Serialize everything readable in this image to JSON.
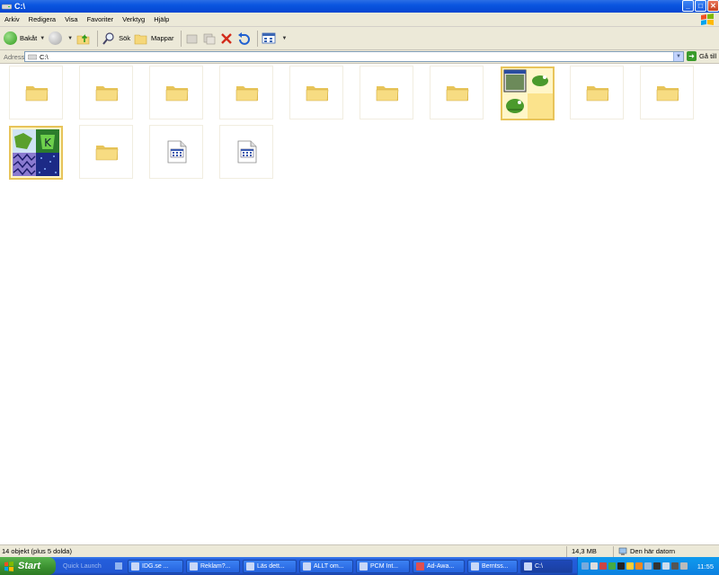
{
  "window": {
    "title": "C:\\",
    "minimize": "_",
    "maximize": "□",
    "close": "✕"
  },
  "menu": [
    "Arkiv",
    "Redigera",
    "Visa",
    "Favoriter",
    "Verktyg",
    "Hjälp"
  ],
  "toolbar": {
    "back_label": "Bakåt",
    "search_label": "Sök",
    "folders_label": "Mappar"
  },
  "address": {
    "label": "Adress",
    "value": "C:\\",
    "go_label": "Gå till"
  },
  "items": [
    {
      "type": "folder"
    },
    {
      "type": "folder"
    },
    {
      "type": "folder"
    },
    {
      "type": "folder"
    },
    {
      "type": "folder"
    },
    {
      "type": "folder"
    },
    {
      "type": "folder"
    },
    {
      "type": "thumbnail-crocodiles"
    },
    {
      "type": "folder"
    },
    {
      "type": "folder"
    },
    {
      "type": "thumbnail-mixed"
    },
    {
      "type": "folder"
    },
    {
      "type": "document"
    },
    {
      "type": "document"
    }
  ],
  "status": {
    "count": "14 objekt (plus 5 dolda)",
    "size": "14,3 MB",
    "location": "Den här datorn"
  },
  "taskbar": {
    "start": "Start",
    "quick_launch": "Quick Launch",
    "tasks": [
      "IDG.se ...",
      "Reklam?...",
      "Läs dett...",
      "ALLT om...",
      "PCM Int...",
      "Ad-Awa...",
      "Berntss...",
      "C:\\"
    ],
    "clock": "11:55"
  },
  "colors": {
    "accent": "#0a55e0",
    "folder": "#f5d77a",
    "start_green": "#3a8f2f"
  }
}
